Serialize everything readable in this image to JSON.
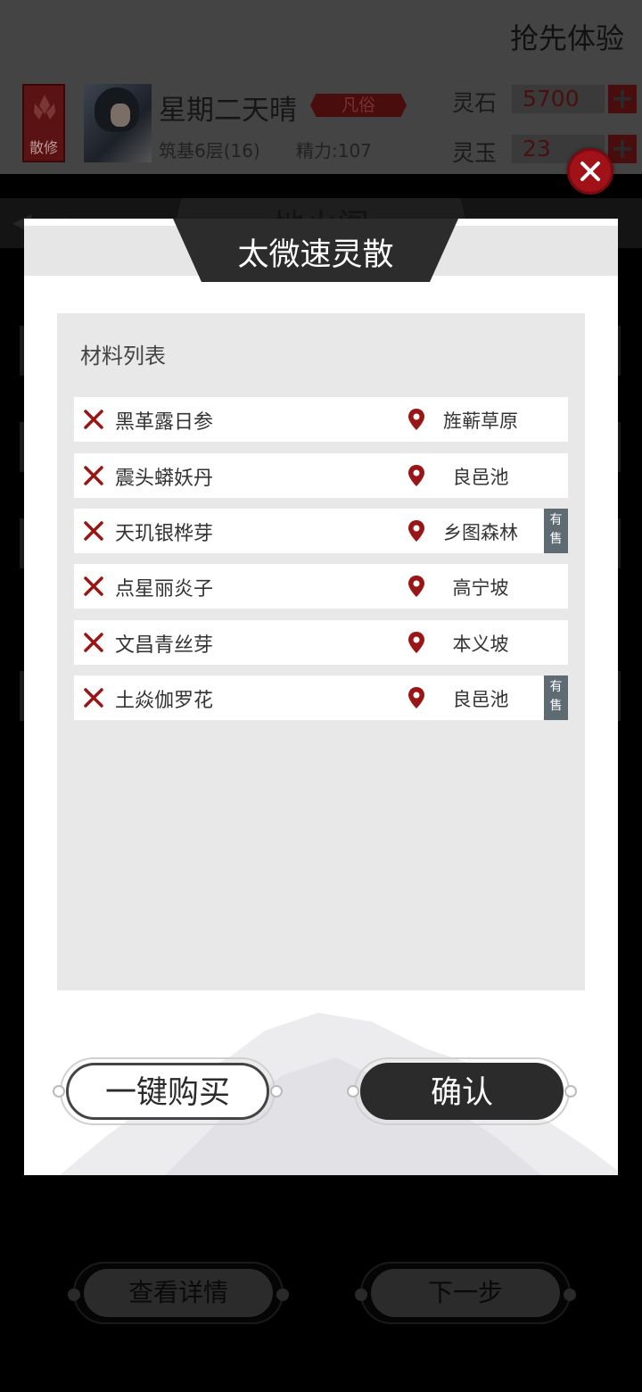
{
  "header": {
    "title": "抢先体验",
    "sect_label": "散修",
    "player_name": "星期二天晴",
    "rank": "凡俗",
    "level": "筑基6层(16)",
    "energy": "精力:107",
    "resources": [
      {
        "label": "灵石",
        "value": "5700"
      },
      {
        "label": "灵玉",
        "value": "23"
      }
    ]
  },
  "background_tab": {
    "back_label": "离开",
    "page_title": "地火阁"
  },
  "dialog": {
    "title": "太微速灵散",
    "panel_label": "材料列表",
    "materials": [
      {
        "name": "黑革露日参",
        "location": "旌蕲草原",
        "on_sale": false
      },
      {
        "name": "震头蟒妖丹",
        "location": "良邑池",
        "on_sale": false
      },
      {
        "name": "天玑银桦芽",
        "location": "乡图森林",
        "on_sale": true
      },
      {
        "name": "点星丽炎子",
        "location": "高宁坡",
        "on_sale": false
      },
      {
        "name": "文昌青丝芽",
        "location": "本义坡",
        "on_sale": false
      },
      {
        "name": "土焱伽罗花",
        "location": "良邑池",
        "on_sale": true
      }
    ],
    "sale_badge": "有售",
    "buy_all_label": "一键购买",
    "confirm_label": "确认"
  },
  "footer": {
    "details_label": "查看详情",
    "next_label": "下一步"
  },
  "colors": {
    "accent_red": "#9a1515",
    "dark": "#2b2b2b",
    "panel_bg": "#e8e8e8",
    "sale_badge_bg": "#5e6b73",
    "close_red": "#a01218"
  }
}
